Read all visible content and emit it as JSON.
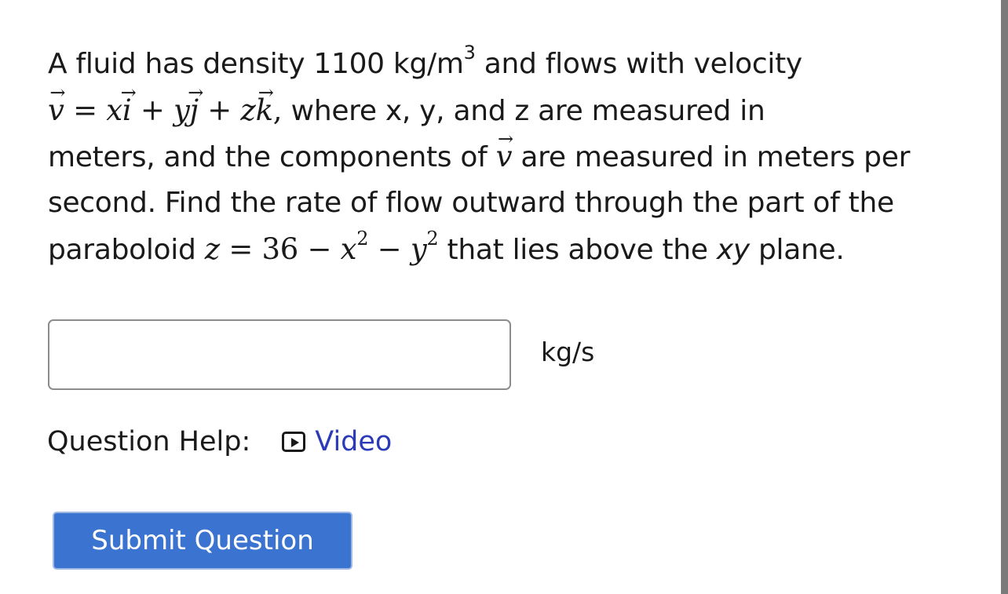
{
  "question": {
    "line1": {
      "a": "A fluid has density 1100 kg/m",
      "exp": "3",
      "b": " and flows with velocity"
    },
    "line2": {
      "v": "v",
      "eq": " = ",
      "x": "x",
      "i": "i",
      "plus1": " + ",
      "y": "y",
      "j": "j",
      "plus2": " + ",
      "z": "z",
      "k": "k",
      "comma": ", ",
      "text": "where x, y, and z are measured in"
    },
    "line3": {
      "a": "meters, and the components of ",
      "v": "v",
      "b": " are measured in meters per"
    },
    "line4": "second. Find the rate of flow outward through the part of the",
    "line5": {
      "a": "paraboloid ",
      "z": "z",
      "eq": " = ",
      "n36": "36",
      "minus1": " − ",
      "x": "x",
      "x_exp": "2",
      "minus2": " − ",
      "y": "y",
      "y_exp": "2",
      "b": " that lies above the ",
      "xy": "xy",
      "c": " plane."
    }
  },
  "answer": {
    "value": "",
    "unit": "kg/s"
  },
  "help": {
    "label": "Question Help:",
    "video_label": "Video",
    "video_icon": "play-icon"
  },
  "submit_label": "Submit Question",
  "colors": {
    "link": "#2b3bb8",
    "button": "#3a73d0",
    "input_border": "#8c8c8c",
    "scrollbar": "#7a7a7a"
  }
}
